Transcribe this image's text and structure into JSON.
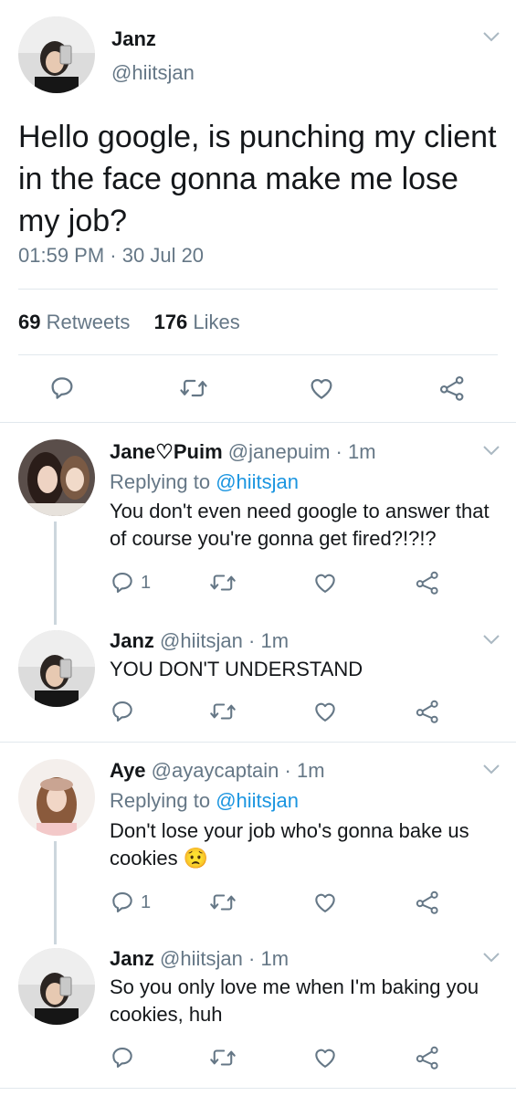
{
  "main_tweet": {
    "name": "Janz",
    "handle": "@hiitsjan",
    "text": "Hello google, is punching my client in the face gonna make me lose my job?",
    "time": "01:59 PM",
    "separator": "·",
    "date": "30 Jul 20",
    "retweets": "69",
    "retweets_label": "Retweets",
    "likes": "176",
    "likes_label": "Likes",
    "actions": [
      "reply-icon",
      "retweet-icon",
      "like-icon",
      "share-icon"
    ]
  },
  "replies": [
    {
      "name": "Jane♡Puim",
      "handle": "@janepuim",
      "sep": "·",
      "age": "1m",
      "replying_prefix": "Replying to",
      "replying_to": "@hiitsjan",
      "text": "You don't even need google to answer that of course you're gonna get fired?!?!?",
      "reply_count": "1"
    },
    {
      "name": "Janz",
      "handle": "@hiitsjan",
      "sep": "·",
      "age": "1m",
      "text": "YOU DON'T UNDERSTAND"
    },
    {
      "name": "Aye",
      "handle": "@ayaycaptain",
      "sep": "·",
      "age": "1m",
      "replying_prefix": "Replying to",
      "replying_to": "@hiitsjan",
      "text": "Don't lose your job who's gonna bake us cookies",
      "emoji": "😟",
      "reply_count": "1"
    },
    {
      "name": "Janz",
      "handle": "@hiitsjan",
      "sep": "·",
      "age": "1m",
      "text": "So you only love me when I'm baking you cookies, huh"
    }
  ],
  "colors": {
    "text": "#14171a",
    "secondary": "#657786",
    "link": "#1b95e0",
    "divider": "#e1e8ed",
    "icon": "#657786"
  }
}
